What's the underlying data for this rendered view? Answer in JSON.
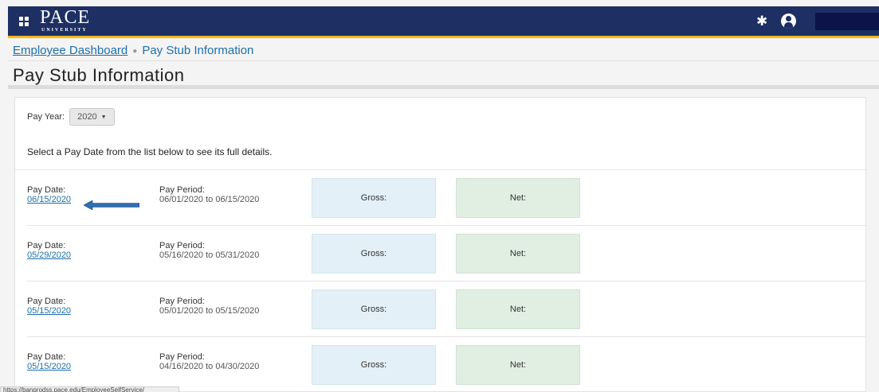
{
  "header": {
    "logo_word": "PACE",
    "logo_sub": "UNIVERSITY",
    "icons": [
      "apps-icon",
      "gear-icon",
      "user-icon"
    ],
    "brand_color": "#1d2f63",
    "accent_color": "#f2b81c"
  },
  "breadcrumb": {
    "home": "Employee Dashboard",
    "current": "Pay Stub Information"
  },
  "page_title": "Pay Stub Information",
  "filter": {
    "year_label": "Pay Year:",
    "year_value": "2020"
  },
  "instruction": "Select a Pay Date from the list below to see its full details.",
  "labels": {
    "pay_date": "Pay Date:",
    "pay_period": "Pay Period:",
    "gross": "Gross:",
    "net": "Net:"
  },
  "stubs": [
    {
      "pay_date": "06/15/2020",
      "pay_period": "06/01/2020 to 06/15/2020"
    },
    {
      "pay_date": "05/29/2020",
      "pay_period": "05/16/2020 to 05/31/2020"
    },
    {
      "pay_date": "05/15/2020",
      "pay_period": "05/01/2020 to 05/15/2020"
    },
    {
      "pay_date": "05/15/2020",
      "pay_period": "04/16/2020 to 04/30/2020"
    }
  ],
  "status_url": "https://banprodss.pace.edu/EmployeeSelfService/"
}
